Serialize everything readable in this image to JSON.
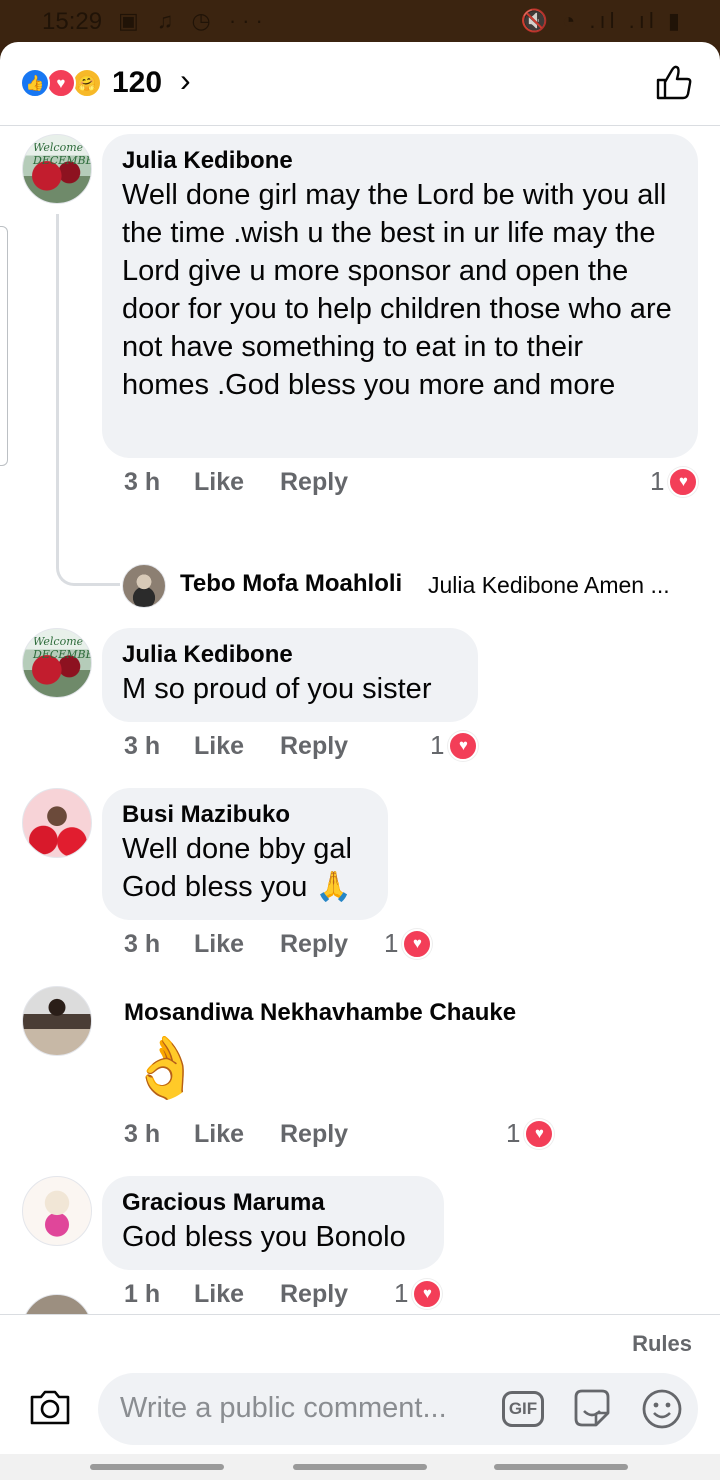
{
  "status_bar": {
    "time": "15:29",
    "left_icons": "▣ ♫ ◷ ···",
    "right_icons": "🔇 ◔ .ıl .ıl ▮"
  },
  "header": {
    "reaction_count": "120",
    "reactions": [
      "like-icon",
      "love-icon",
      "care-icon"
    ],
    "colors": {
      "like": "#1877f2",
      "love": "#f33e58",
      "care": "#f7b928"
    }
  },
  "comments": [
    {
      "author": "Julia Kedibone",
      "text": "Well done girl may the Lord be with you all the time .wish u the best in ur life may the Lord give u more sponsor and open the door for you to help children those who are not have something to eat in to their homes .God bless you more and more",
      "time": "3 h",
      "like": "Like",
      "reply": "Reply",
      "reaction_count": "1",
      "avatar_text": "Welcome DECEMBER",
      "replies": [
        {
          "author": "Tebo Mofa Moahloli",
          "text": "Julia Kedibone Amen ..."
        }
      ]
    },
    {
      "author": "Julia Kedibone",
      "text": "M so proud of you sister",
      "time": "3 h",
      "like": "Like",
      "reply": "Reply",
      "reaction_count": "1",
      "avatar_text": "Welcome DECEMBER"
    },
    {
      "author": "Busi Mazibuko",
      "text_line1": "Well done bby gal",
      "text_line2": "God bless you 🙏",
      "time": "3 h",
      "like": "Like",
      "reply": "Reply",
      "reaction_count": "1"
    },
    {
      "author": "Mosandiwa Nekhavhambe Chauke",
      "emoji": "👌",
      "time": "3 h",
      "like": "Like",
      "reply": "Reply",
      "reaction_count": "1"
    },
    {
      "author": "Gracious Maruma",
      "text": "God bless you Bonolo",
      "time": "1 h",
      "like": "Like",
      "reply": "Reply",
      "reaction_count": "1"
    }
  ],
  "composer": {
    "rules": "Rules",
    "placeholder": "Write a public comment...",
    "gif_label": "GIF"
  }
}
